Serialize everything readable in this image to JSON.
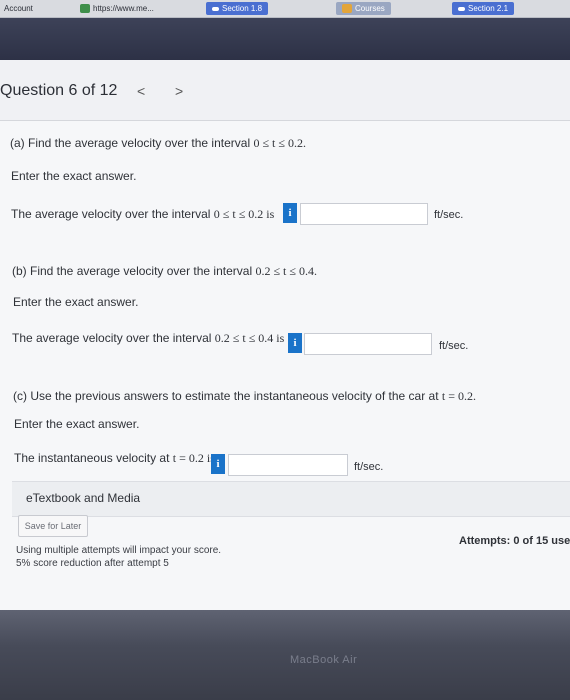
{
  "tabs": {
    "account": "Account",
    "url": "https://www.me...",
    "section_a": "Section 1.8",
    "courses": "Courses",
    "section_b": "Section 2.1"
  },
  "question": {
    "title": "Question 6 of 12",
    "prev": "<",
    "next": ">"
  },
  "part_a": {
    "prompt": "(a) Find the average velocity over the interval",
    "interval": "0 ≤ t ≤ 0.2.",
    "instruction": "Enter the exact answer.",
    "sentence": "The average velocity over the interval",
    "sentence_interval": "0 ≤ t ≤ 0.2 is",
    "info": "i",
    "value": "",
    "unit": "ft/sec."
  },
  "part_b": {
    "prompt": "(b) Find the average velocity over the interval",
    "interval": "0.2 ≤ t ≤ 0.4.",
    "instruction": "Enter the exact answer.",
    "sentence": "The average velocity over the interval",
    "sentence_interval": "0.2 ≤ t ≤ 0.4 is",
    "info": "i",
    "value": "",
    "unit": "ft/sec."
  },
  "part_c": {
    "prompt": "(c) Use the previous answers to estimate the instantaneous velocity of the car at",
    "t_expr": "t = 0.2.",
    "instruction": "Enter the exact answer.",
    "sentence": "The instantaneous velocity at",
    "sentence_expr": "t = 0.2 is",
    "info": "i",
    "value": "",
    "unit": "ft/sec."
  },
  "etextbook": "eTextbook and Media",
  "save_label": "Save for Later",
  "attempts": "Attempts: 0 of 15 use",
  "notes": {
    "line1": "Using multiple attempts will impact your score.",
    "line2": "5% score reduction after attempt 5"
  },
  "laptop_brand": "MacBook Air",
  "colors": {
    "info_button": "#1a73c9",
    "tab_accent": "#4a6fd1",
    "page_bg": "#f6f7f9"
  }
}
